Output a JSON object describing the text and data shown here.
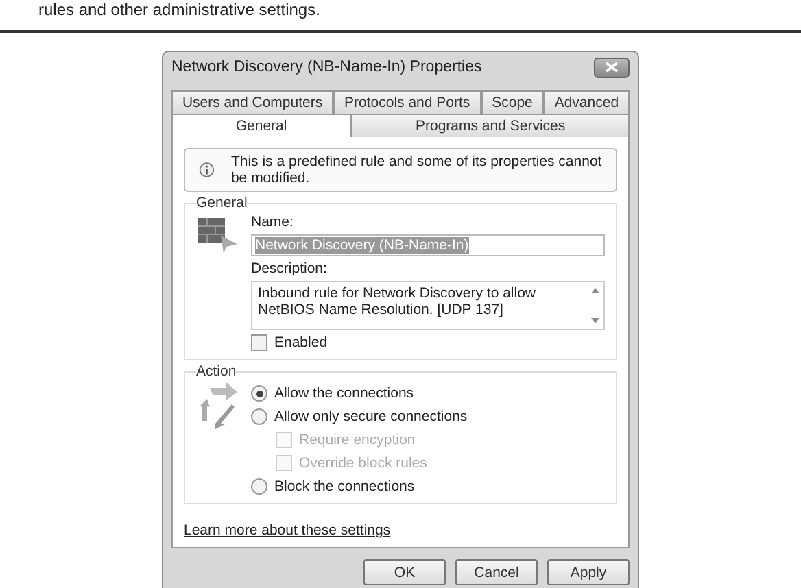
{
  "page_text": "rules and other administrative settings.",
  "dialog": {
    "title": "Network Discovery (NB-Name-In) Properties",
    "tab_rows": [
      [
        {
          "label": "Users and Computers",
          "selected": false
        },
        {
          "label": "Protocols and Ports",
          "selected": false
        },
        {
          "label": "Scope",
          "selected": false
        },
        {
          "label": "Advanced",
          "selected": false
        }
      ],
      [
        {
          "label": "General",
          "selected": true
        },
        {
          "label": "Programs and Services",
          "selected": false
        }
      ]
    ],
    "info": "This is a predefined rule and some of its properties cannot be modified.",
    "general": {
      "label": "General",
      "name_label": "Name:",
      "name_value": "Network Discovery (NB-Name-In)",
      "description_label": "Description:",
      "description": "Inbound rule for Network Discovery to allow NetBIOS Name Resolution. [UDP 137]",
      "enabled": {
        "label": "Enabled",
        "checked": false
      }
    },
    "action": {
      "label": "Action",
      "options": [
        {
          "kind": "radio",
          "label": "Allow the connections",
          "selected": true,
          "disabled": false
        },
        {
          "kind": "radio",
          "label": "Allow only secure connections",
          "selected": false,
          "disabled": false
        },
        {
          "kind": "checkbox",
          "label": "Require encyption",
          "checked": false,
          "disabled": true
        },
        {
          "kind": "checkbox",
          "label": "Override block rules",
          "checked": false,
          "disabled": true
        },
        {
          "kind": "radio",
          "label": "Block the connections",
          "selected": false,
          "disabled": false
        }
      ]
    },
    "link": "Learn more about these settings",
    "buttons": [
      "OK",
      "Cancel",
      "Apply"
    ]
  }
}
